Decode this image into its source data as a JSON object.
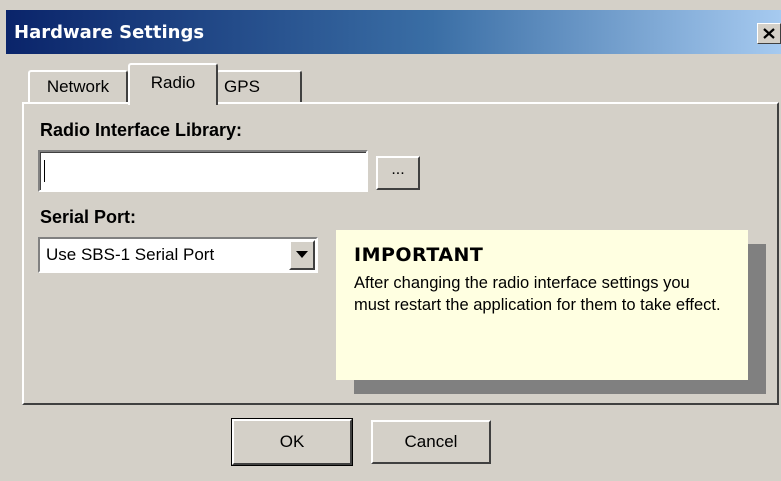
{
  "window": {
    "title": "Hardware Settings"
  },
  "tabs": [
    {
      "label": "Network",
      "active": false
    },
    {
      "label": "Radio",
      "active": true
    },
    {
      "label": "GPS",
      "active": false
    }
  ],
  "radio_tab": {
    "library_label": "Radio Interface Library:",
    "library_value": "",
    "browse_label": "...",
    "serial_port_label": "Serial Port:",
    "serial_port_value": "Use SBS-1 Serial Port"
  },
  "notice": {
    "title": "IMPORTANT",
    "body": "After changing the radio interface settings you must restart the application for them to take effect."
  },
  "buttons": {
    "ok": "OK",
    "cancel": "Cancel"
  },
  "colors": {
    "title_gradient_start": "#0a246a",
    "title_gradient_end": "#a6caf0",
    "face": "#d4d0c8",
    "note_background": "#ffffe1"
  }
}
